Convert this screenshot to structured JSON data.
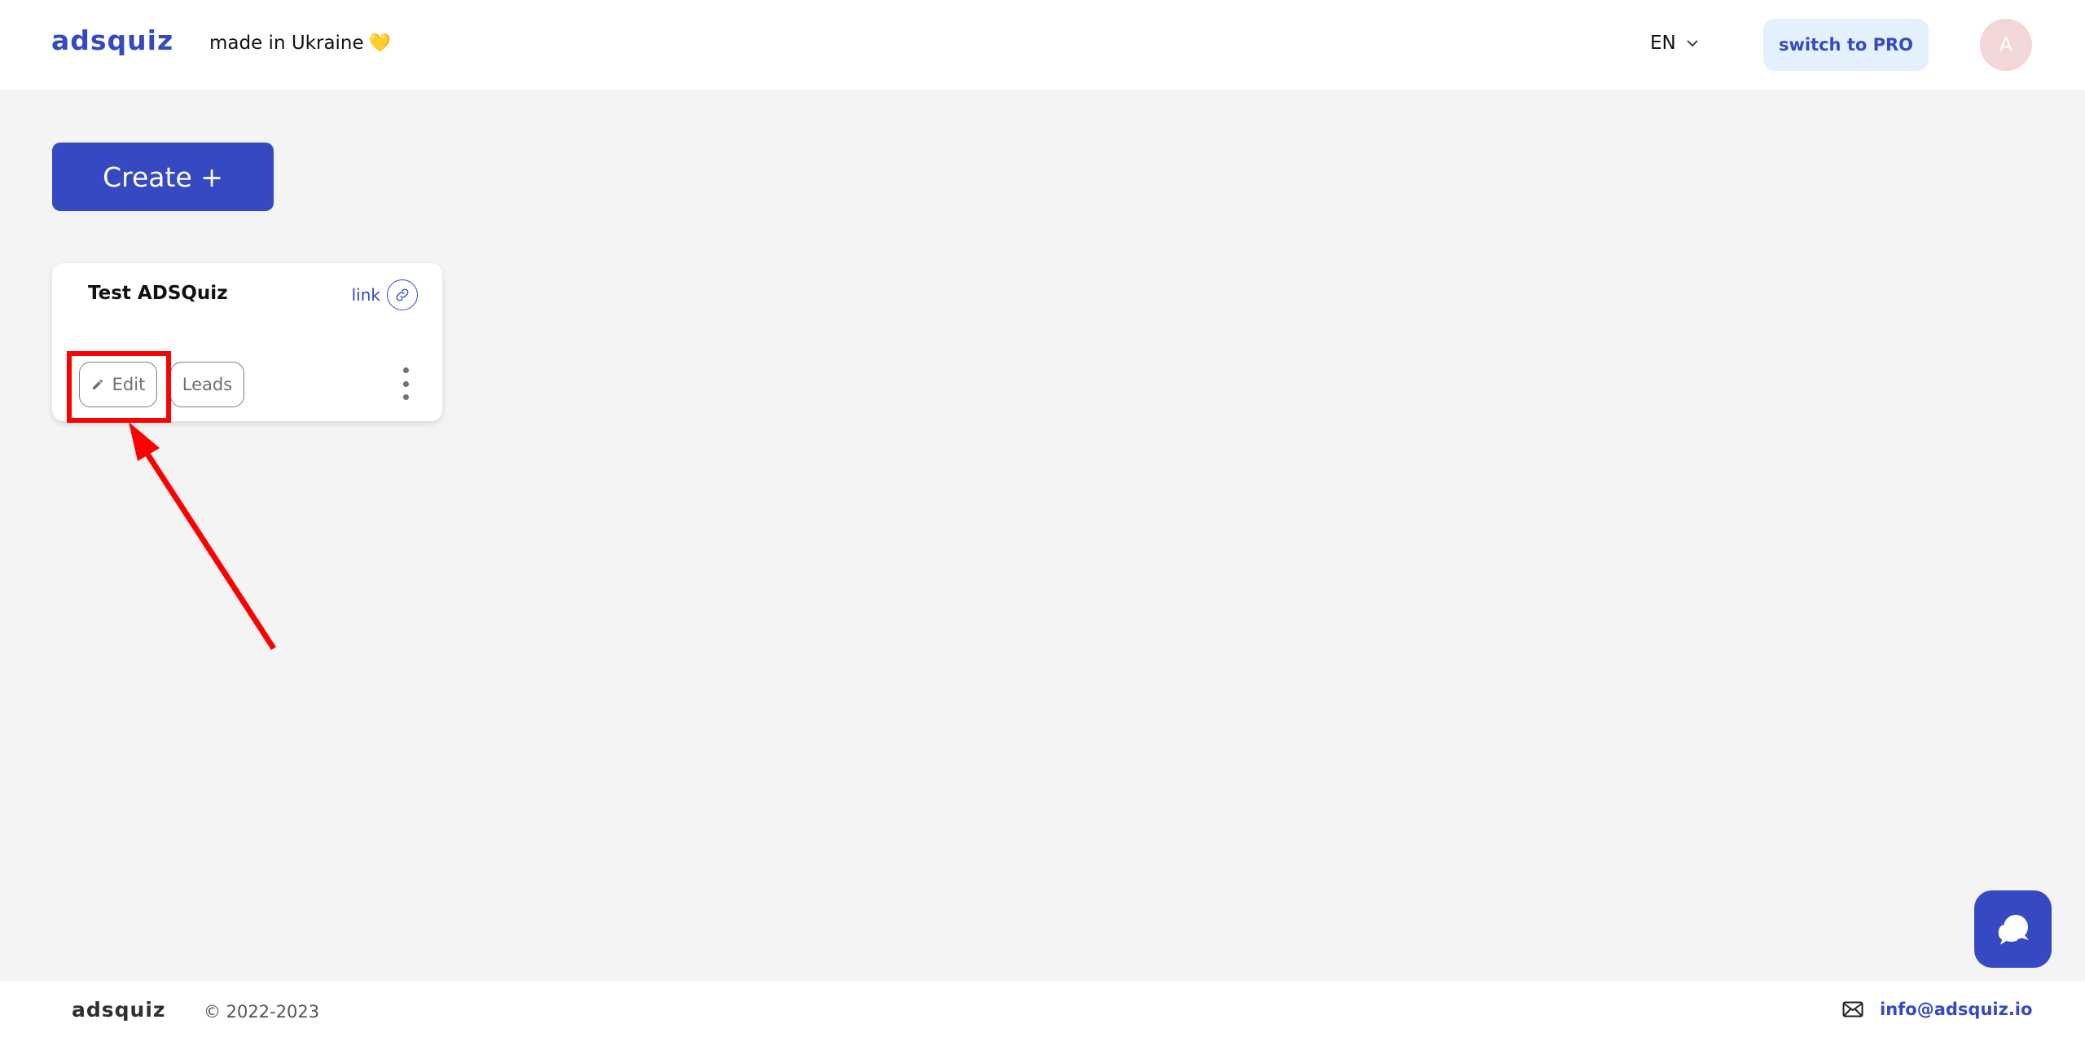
{
  "header": {
    "logo": "adsquiz",
    "tagline": "made in Ukraine",
    "tagline_emoji": "💛",
    "language": "EN",
    "pro_button": "switch to PRO",
    "avatar_initial": "A"
  },
  "main": {
    "create_button": "Create +",
    "quizzes": [
      {
        "title": "Test ADSQuiz",
        "link_label": "link",
        "edit_label": "Edit",
        "leads_label": "Leads"
      }
    ]
  },
  "footer": {
    "logo": "adsquiz",
    "copyright": "© 2022-2023",
    "email": "info@adsquiz.io"
  },
  "colors": {
    "brand": "#3549c3",
    "annotation": "#ff0000"
  }
}
